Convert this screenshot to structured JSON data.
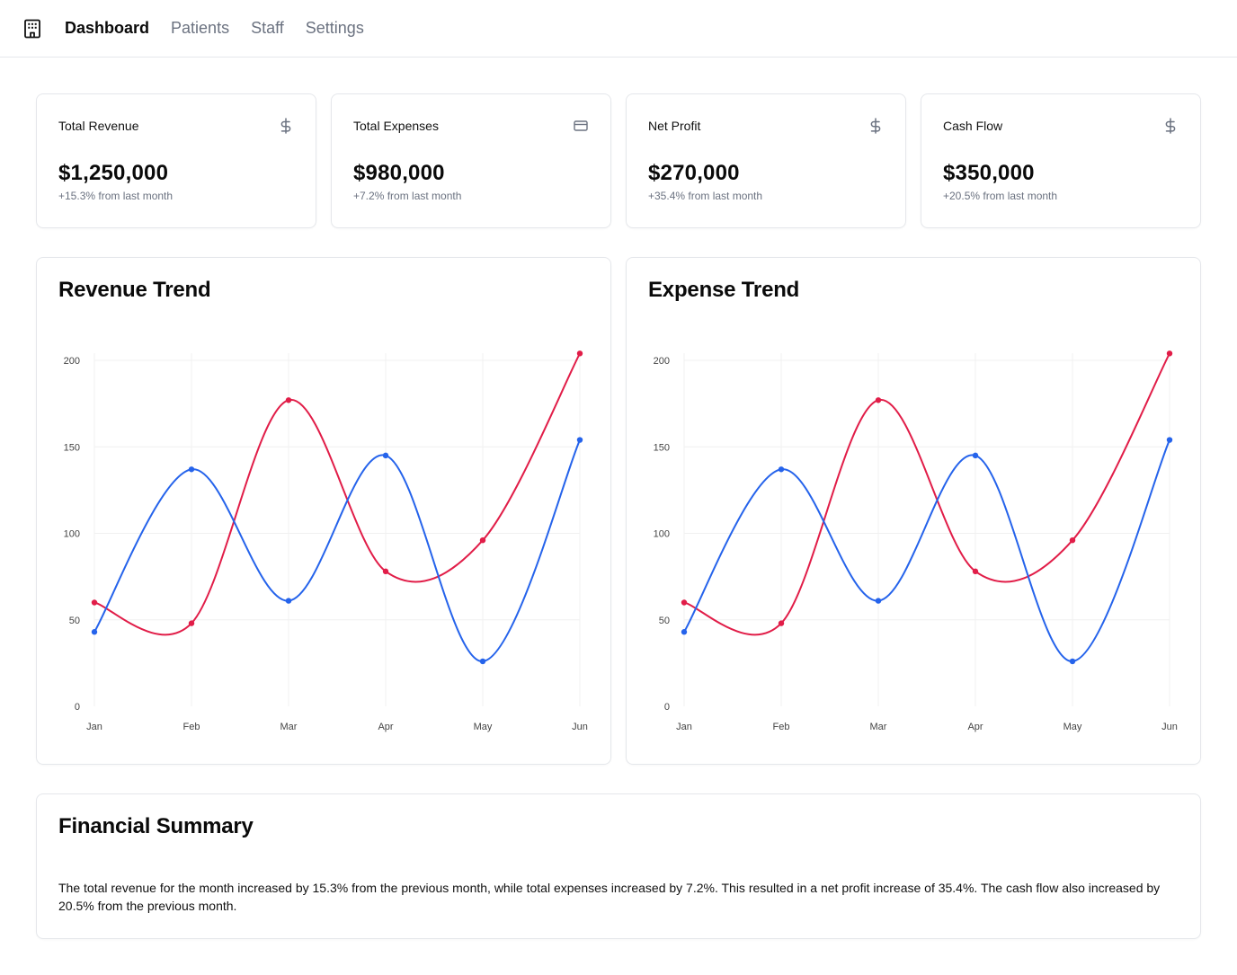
{
  "nav": {
    "logo_icon": "building-icon",
    "items": [
      {
        "label": "Dashboard",
        "active": true
      },
      {
        "label": "Patients",
        "active": false
      },
      {
        "label": "Staff",
        "active": false
      },
      {
        "label": "Settings",
        "active": false
      }
    ]
  },
  "stats": [
    {
      "title": "Total Revenue",
      "icon": "dollar-icon",
      "value": "$1,250,000",
      "change": "+15.3% from last month"
    },
    {
      "title": "Total Expenses",
      "icon": "credit-card-icon",
      "value": "$980,000",
      "change": "+7.2% from last month"
    },
    {
      "title": "Net Profit",
      "icon": "dollar-icon",
      "value": "$270,000",
      "change": "+35.4% from last month"
    },
    {
      "title": "Cash Flow",
      "icon": "dollar-icon",
      "value": "$350,000",
      "change": "+20.5% from last month"
    }
  ],
  "colors": {
    "series_red": "#e11d48",
    "series_blue": "#2563eb",
    "grid": "#f0f0f0",
    "tick_text": "#444444"
  },
  "chart_data": [
    {
      "type": "line",
      "title": "Revenue Trend",
      "categories": [
        "Jan",
        "Feb",
        "Mar",
        "Apr",
        "May",
        "Jun"
      ],
      "series": [
        {
          "color": "#e11d48",
          "values": [
            60,
            48,
            177,
            78,
            96,
            204
          ]
        },
        {
          "color": "#2563eb",
          "values": [
            43,
            137,
            61,
            145,
            26,
            154
          ]
        }
      ],
      "ylim": [
        0,
        200
      ],
      "yticks": [
        "0",
        "50",
        "100",
        "150",
        "200"
      ],
      "grid": true
    },
    {
      "type": "line",
      "title": "Expense Trend",
      "categories": [
        "Jan",
        "Feb",
        "Mar",
        "Apr",
        "May",
        "Jun"
      ],
      "series": [
        {
          "color": "#e11d48",
          "values": [
            60,
            48,
            177,
            78,
            96,
            204
          ]
        },
        {
          "color": "#2563eb",
          "values": [
            43,
            137,
            61,
            145,
            26,
            154
          ]
        }
      ],
      "ylim": [
        0,
        200
      ],
      "yticks": [
        "0",
        "50",
        "100",
        "150",
        "200"
      ],
      "grid": true
    }
  ],
  "summary": {
    "title": "Financial Summary",
    "text": "The total revenue for the month increased by 15.3% from the previous month, while total expenses increased by 7.2%. This resulted in a net profit increase of 35.4%. The cash flow also increased by 20.5% from the previous month."
  }
}
